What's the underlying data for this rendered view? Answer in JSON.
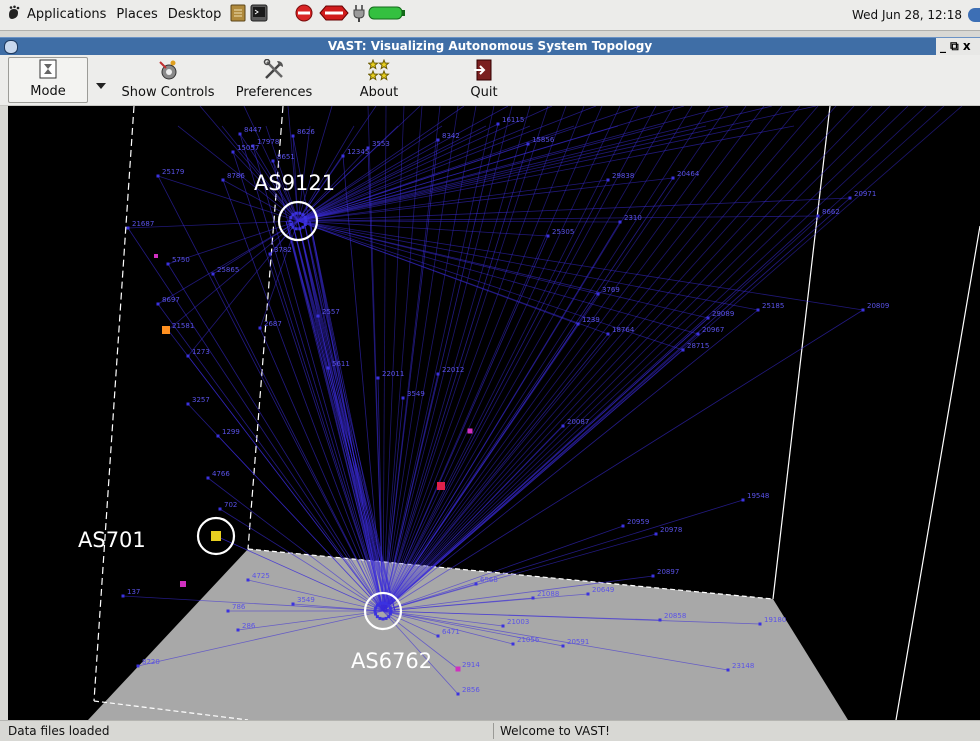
{
  "top_panel": {
    "menus": [
      "Applications",
      "Places",
      "Desktop"
    ],
    "clock": "Wed Jun 28, 12:18",
    "icons": [
      "gnome-foot-icon",
      "notes-icon",
      "terminal-icon",
      "no-entry-icon",
      "stop-sign-icon",
      "power-plug-icon",
      "battery-icon",
      "network-icon"
    ]
  },
  "window": {
    "title": "VAST: Visualizing Autonomous System Topology",
    "controls": "_ ⧉ x"
  },
  "toolbar": {
    "mode": "Mode",
    "show_controls": "Show Controls",
    "preferences": "Preferences",
    "about": "About",
    "quit": "Quit"
  },
  "annotations": {
    "as9121": "AS9121",
    "as701": "AS701",
    "as6762": "AS6762"
  },
  "node_labels": [
    "8447",
    "8626",
    "17978",
    "15057",
    "16115",
    "8651",
    "15856",
    "3553",
    "12345",
    "8342",
    "29838",
    "20464",
    "25179",
    "8786",
    "8662",
    "20971",
    "21687",
    "2310",
    "25305",
    "25865",
    "5750",
    "3782",
    "3769",
    "25185",
    "20809",
    "21581",
    "1239",
    "29089",
    "20967",
    "18764",
    "28715",
    "2687",
    "2557",
    "5611",
    "22011",
    "22012",
    "3257",
    "3549",
    "20087",
    "1299",
    "4766",
    "19548",
    "702",
    "20959",
    "20978",
    "4725",
    "6568",
    "20897",
    "21088",
    "20649",
    "137",
    "786",
    "20858",
    "19180",
    "286",
    "3549",
    "21003",
    "6471",
    "21056",
    "20591",
    "23148",
    "2856",
    "2914",
    "1273",
    "8697",
    "8220"
  ],
  "colors": {
    "edge": "#3a2bd8",
    "node": "#3b32e0",
    "label": "#5a52e8",
    "floor": "#a8a8a8",
    "highlight_ring": "#ffffff",
    "orange_node": "#ff9020",
    "red_node": "#e0204a",
    "magenta_node": "#d030c0"
  },
  "status": {
    "left": "Data files loaded",
    "right": "Welcome to VAST!"
  }
}
